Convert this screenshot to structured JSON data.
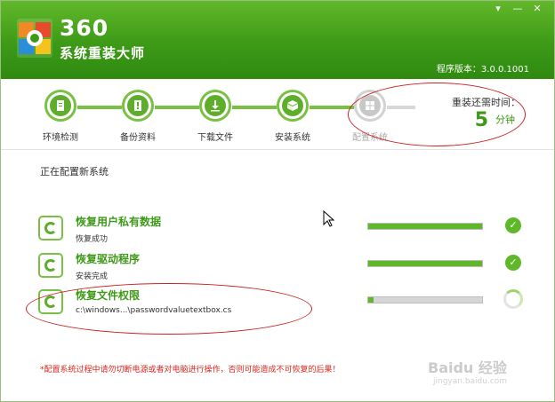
{
  "app": {
    "name": "360",
    "subtitle": "系统重装大师",
    "version": "程序版本：3.0.0.1001"
  },
  "window_controls": {
    "menu": "▾",
    "minimize": "—",
    "close": "✕"
  },
  "steps": [
    {
      "label": "环境检测",
      "state": "done"
    },
    {
      "label": "备份资料",
      "state": "done"
    },
    {
      "label": "下载文件",
      "state": "done"
    },
    {
      "label": "安装系统",
      "state": "done"
    },
    {
      "label": "配置系统",
      "state": "current"
    }
  ],
  "remaining": {
    "label": "重装还需时间：",
    "value": "5",
    "unit": "分钟"
  },
  "section_title": "正在配置新系统",
  "tasks": [
    {
      "title": "恢复用户私有数据",
      "status": "恢复成功",
      "progress": 1.0,
      "state": "done"
    },
    {
      "title": "恢复驱动程序",
      "status": "安装完成",
      "progress": 1.0,
      "state": "done"
    },
    {
      "title": "恢复文件权限",
      "status": "c:\\windows...\\passwordvaluetextbox.cs",
      "progress": 0.05,
      "state": "running"
    }
  ],
  "warning": "*配置系统过程中请勿切断电源或者对电脑进行操作，否则可能造成不可恢复的后果！",
  "watermark": {
    "main": "Baidu 经验",
    "sub": "jingyan.baidu.com"
  },
  "colors": {
    "accent": "#3d9a17",
    "warning": "#d9261c",
    "annotation": "#c22222"
  }
}
